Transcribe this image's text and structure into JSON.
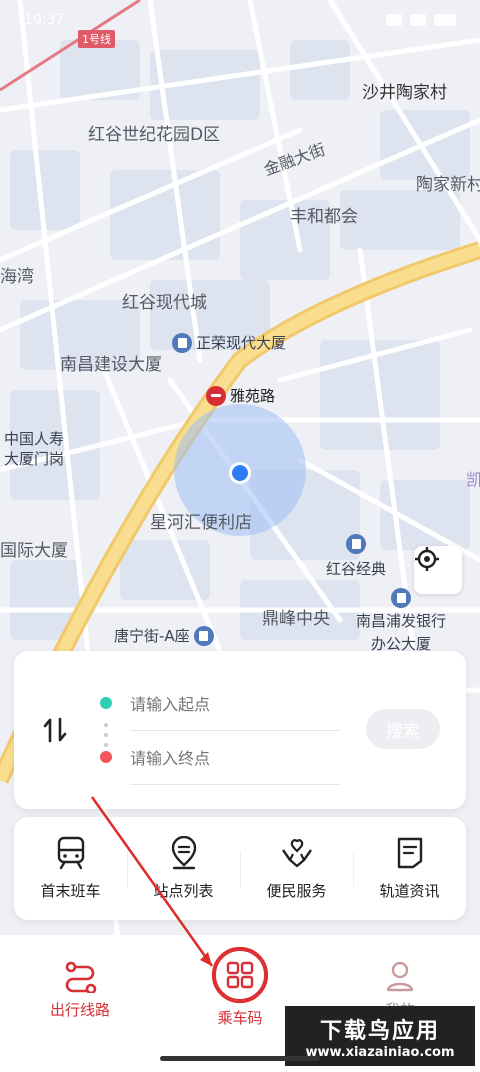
{
  "status": {
    "time": "10:37"
  },
  "map": {
    "labels": {
      "line1": "1号线",
      "shajing": "沙井陶家村",
      "honggu_d": "红谷世纪花园D区",
      "jinrong": "金融大街",
      "taojia": "陶家新村",
      "fenghe": "丰和都会",
      "haiwan": "海湾",
      "honggu_xiandai": "红谷现代城",
      "zhengrong": "正荣现代大厦",
      "nanchang_jianshe": "南昌建设大厦",
      "yayuan": "雅苑路",
      "zhongguo_renshou": "中国人寿",
      "dasha_menggang": "大厦门岗",
      "xinghe": "星河汇便利店",
      "guoji": "国际大厦",
      "kai": "凯",
      "honggu_jingdian": "红谷经典",
      "dingfeng": "鼎峰中央",
      "tangning": "唐宁街-A座",
      "pufa_1": "南昌浦发银行",
      "pufa_2": "办公大厦"
    }
  },
  "route": {
    "start_placeholder": "请输入起点",
    "end_placeholder": "请输入终点",
    "search_label": "搜索",
    "start_color": "#2ecfb3",
    "end_color": "#f0565a"
  },
  "quick": [
    {
      "label": "首末班车",
      "icon": "train-icon"
    },
    {
      "label": "站点列表",
      "icon": "station-list-icon"
    },
    {
      "label": "便民服务",
      "icon": "heart-hands-icon"
    },
    {
      "label": "轨道资讯",
      "icon": "news-icon"
    }
  ],
  "nav": [
    {
      "label": "出行线路",
      "icon": "route-icon"
    },
    {
      "label": "乘车码",
      "icon": "qr-code-icon"
    },
    {
      "label": "我的",
      "icon": "user-icon"
    }
  ],
  "watermark": {
    "title": "下载鸟应用",
    "url": "www.xiazainiao.com"
  },
  "colors": {
    "accent": "#d62f36",
    "road": "#f9de8f"
  }
}
